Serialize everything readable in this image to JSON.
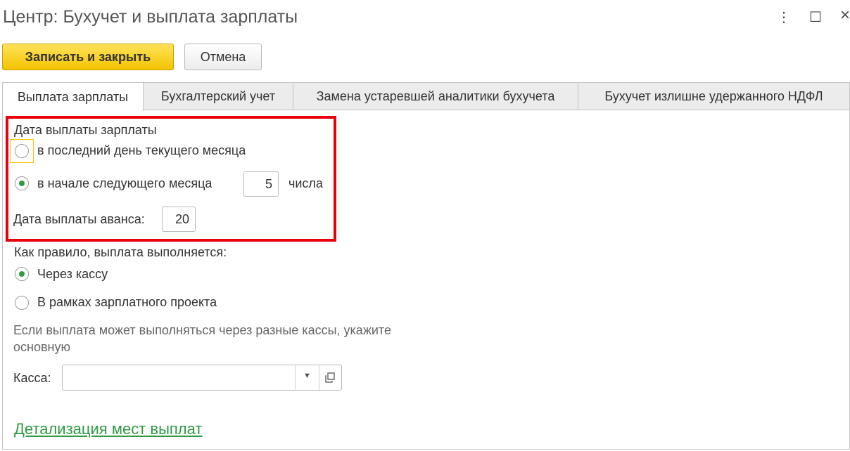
{
  "window": {
    "title": "Центр: Бухучет и выплата зарплаты",
    "more_glyph": "⋮",
    "maximize_glyph": "☐",
    "close_glyph": "×"
  },
  "toolbar": {
    "save_close_label": "Записать и закрыть",
    "cancel_label": "Отмена"
  },
  "tabs": [
    {
      "label": "Выплата зарплаты",
      "active": true
    },
    {
      "label": "Бухгалтерский учет",
      "active": false
    },
    {
      "label": "Замена устаревшей аналитики бухучета",
      "active": false
    },
    {
      "label": "Бухучет излишне удержанного НДФЛ",
      "active": false
    }
  ],
  "salary_date": {
    "group_title": "Дата выплаты зарплаты",
    "option_last_day": "в последний день текущего месяца",
    "option_next_month": "в начале следующего месяца",
    "next_month_day": "5",
    "day_suffix": "числа",
    "advance_label": "Дата выплаты аванса:",
    "advance_day": "20",
    "selected": "next_month"
  },
  "payment_method": {
    "group_title": "Как правило, выплата выполняется:",
    "option_cash": "Через кассу",
    "option_project": "В рамках зарплатного проекта",
    "selected": "cash"
  },
  "cash_desk": {
    "hint": "Если выплата может выполняться через разные кассы, укажите основную",
    "label": "Касса:",
    "value": ""
  },
  "details_link": "Детализация мест выплат",
  "colors": {
    "accent_green": "#2e9a45",
    "primary_button": "#f3c400",
    "highlight_red": "#e8000b"
  }
}
